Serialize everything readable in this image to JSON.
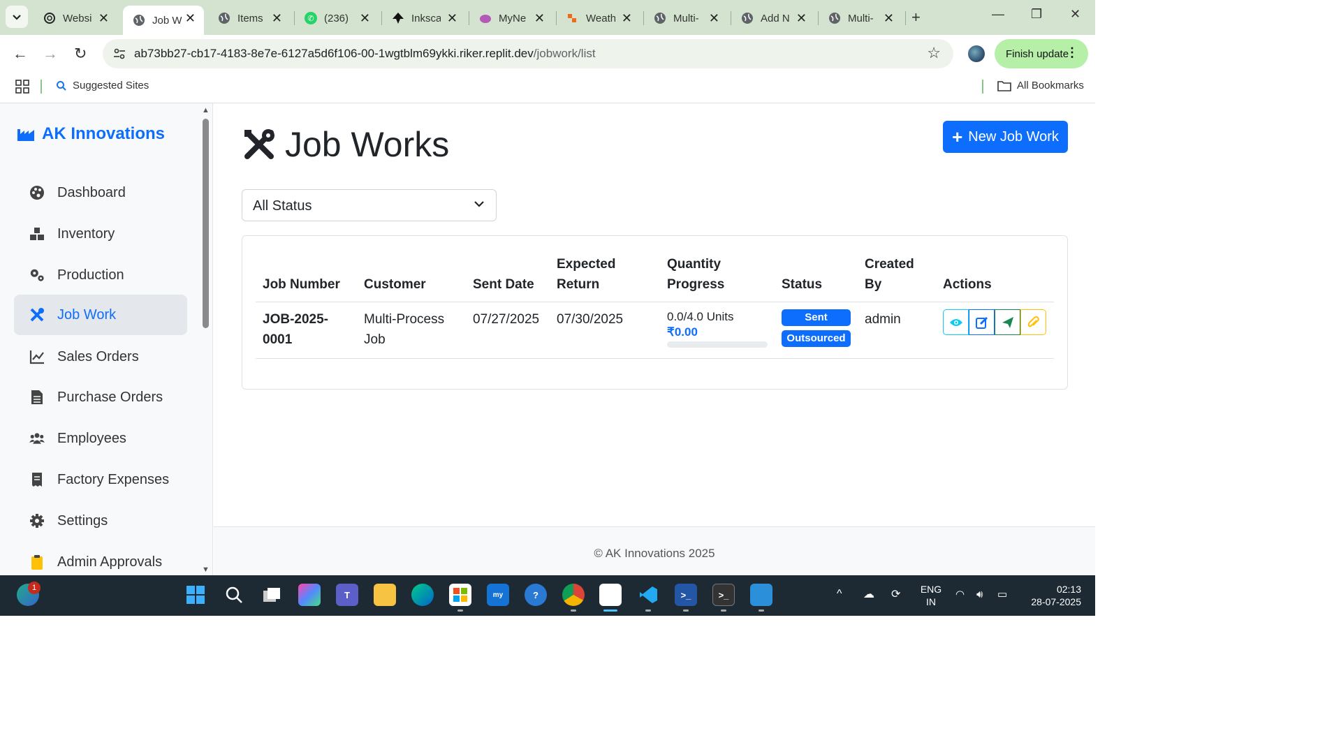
{
  "browser": {
    "tabs": [
      {
        "title": "Websi",
        "icon": "openai-icon"
      },
      {
        "title": "Job W",
        "icon": "globe-icon",
        "active": true
      },
      {
        "title": "Items",
        "icon": "globe-icon"
      },
      {
        "title": "(236)",
        "icon": "whatsapp-icon"
      },
      {
        "title": "Inksca",
        "icon": "inkscape-icon"
      },
      {
        "title": "MyNe",
        "icon": "brain-icon"
      },
      {
        "title": "Weath",
        "icon": "weather-icon"
      },
      {
        "title": "Multi-",
        "icon": "globe-icon"
      },
      {
        "title": "Add N",
        "icon": "globe-icon"
      },
      {
        "title": "Multi-",
        "icon": "globe-icon"
      }
    ],
    "url_host": "ab73bb27-cb17-4183-8e7e-6127a5d6f106-00-1wgtblm69ykki.riker.replit.dev",
    "url_path": "/jobwork/list",
    "finish_update_label": "Finish update",
    "bookmarks": {
      "suggested": "Suggested Sites",
      "all": "All Bookmarks"
    }
  },
  "app": {
    "brand": "AK Innovations",
    "nav": [
      {
        "label": "Dashboard",
        "icon": "palette-icon"
      },
      {
        "label": "Inventory",
        "icon": "boxes-icon"
      },
      {
        "label": "Production",
        "icon": "gears-icon"
      },
      {
        "label": "Job Work",
        "icon": "tools-icon",
        "active": true
      },
      {
        "label": "Sales Orders",
        "icon": "chart-line-icon"
      },
      {
        "label": "Purchase Orders",
        "icon": "file-icon"
      },
      {
        "label": "Employees",
        "icon": "users-icon"
      },
      {
        "label": "Factory Expenses",
        "icon": "receipt-icon"
      },
      {
        "label": "Settings",
        "icon": "gear-icon"
      },
      {
        "label": "Admin Approvals",
        "icon": "clipboard-check-icon"
      }
    ],
    "page_title": "Job Works",
    "new_button": "New Job Work",
    "status_filter": {
      "selected": "All Status"
    },
    "table": {
      "headers": [
        "Job Number",
        "Customer",
        "Sent Date",
        "Expected Return",
        "Quantity Progress",
        "Status",
        "Created By",
        "Actions"
      ],
      "rows": [
        {
          "job_number": "JOB-2025-0001",
          "customer": "Multi-Process Job",
          "sent_date": "07/27/2025",
          "expected_return": "07/30/2025",
          "qty_units": "0.0/4.0 Units",
          "qty_amount": "₹0.00",
          "progress": 0,
          "status": "Sent",
          "type": "Outsourced",
          "created_by": "admin"
        }
      ]
    },
    "footer": "© AK Innovations 2025",
    "colors": {
      "primary": "#0d6efd",
      "info": "#0dcaf0",
      "success": "#198754",
      "warning": "#ffc107"
    }
  },
  "taskbar": {
    "notification_count": "1",
    "lang_line1": "ENG",
    "lang_line2": "IN",
    "time": "02:13",
    "date": "28-07-2025"
  }
}
